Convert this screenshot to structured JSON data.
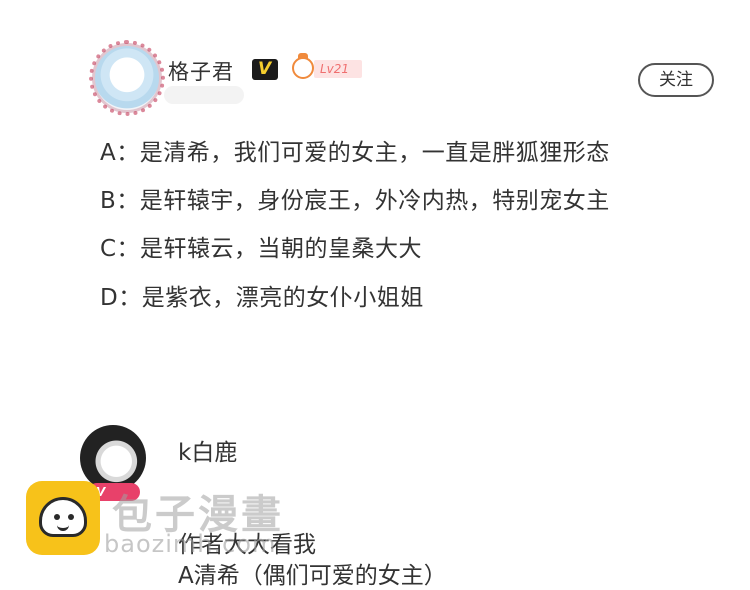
{
  "post": {
    "author": {
      "name": "格子君",
      "vip_badge": "V",
      "level": "Lv21"
    },
    "follow_label": "关注",
    "options": [
      "A：是清希，我们可爱的女主，一直是胖狐狸形态",
      "B：是轩辕宇，身份宸王，外冷内热，特别宠女主",
      "C：是轩辕云，当朝的皇桑大大",
      "D：是紫衣，漂亮的女仆小姐姐"
    ]
  },
  "comment": {
    "user": "k白鹿",
    "level_badge": "V",
    "lines": [
      "作者大大看我",
      "A清希（偶们可爱的女主）"
    ]
  },
  "watermark": {
    "title": "包子漫畫",
    "url": "baozimh.com"
  },
  "colors": {
    "vip_yellow": "#f6cf2e",
    "level_red": "#ef6f6f",
    "comment_badge": "#e8416a",
    "logo_yellow": "#f7c21a"
  }
}
